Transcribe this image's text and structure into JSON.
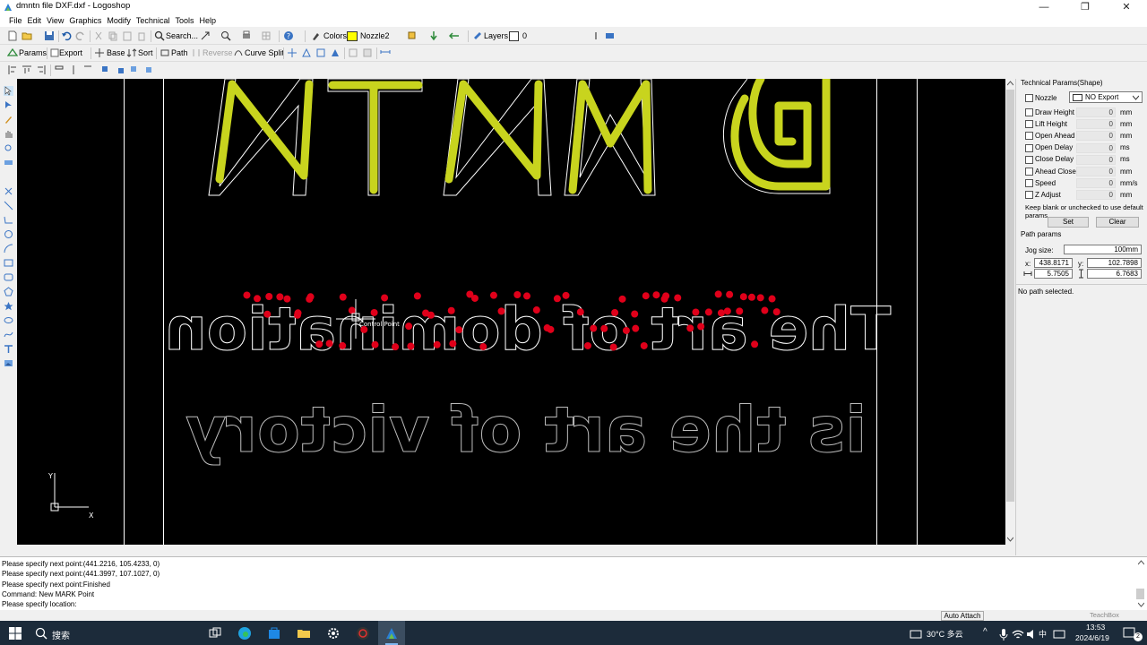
{
  "window": {
    "title": "dmntn file DXF.dxf - Logoshop",
    "minimize_glyph": "—",
    "maximize_glyph": "❐",
    "close_glyph": "✕"
  },
  "menu": [
    "File",
    "Edit",
    "View",
    "Graphics",
    "Modify",
    "Technical",
    "Tools",
    "Help"
  ],
  "toolbar1": {
    "search_label": "Search...",
    "colors_label": "Colors",
    "nozzle_label": "Nozzle2",
    "nozzle_color": "#ffff00",
    "layers_label": "Layers",
    "layer_value": "0"
  },
  "toolbar2": {
    "params_label": "Params",
    "export_label": "Export",
    "base_label": "Base",
    "sort_label": "Sort",
    "path_label": "Path",
    "reverse_label": "Reverse",
    "curve_split_label": "Curve Split"
  },
  "canvas": {
    "background": "#000000",
    "accent_fill": "#c8d41e",
    "control_point_color": "#e0001a",
    "line1": "dmntn@",
    "line2": "The art of domination",
    "line3": "is the art of victory",
    "tooltip": "Control Point",
    "axis_y": "Y",
    "axis_x": "X"
  },
  "technical_params": {
    "title": "Technical Params(Shape)",
    "nozzle_label": "Nozzle",
    "nozzle_select": "NO Export",
    "rows": [
      {
        "label": "Draw Height",
        "value": "0",
        "unit": "mm"
      },
      {
        "label": "Lift Height",
        "value": "0",
        "unit": "mm"
      },
      {
        "label": "Open Ahead",
        "value": "0",
        "unit": "mm"
      },
      {
        "label": "Open Delay",
        "value": "0",
        "unit": "ms"
      },
      {
        "label": "Close Delay",
        "value": "0",
        "unit": "ms"
      },
      {
        "label": "Ahead Close",
        "value": "0",
        "unit": "mm"
      },
      {
        "label": "Speed",
        "value": "0",
        "unit": "mm/s"
      },
      {
        "label": "Z Adjust",
        "value": "0",
        "unit": "mm"
      }
    ],
    "hint": "Keep blank or unchecked to use default params",
    "set_label": "Set",
    "clear_label": "Clear"
  },
  "path_params": {
    "title": "Path params",
    "jog_label": "Jog size:",
    "jog_value": "100mm",
    "x_label": "x:",
    "x_value": "438.8171",
    "y_label": "y:",
    "y_value": "102.7898",
    "w_value": "5.7505",
    "h_value": "6.7683",
    "status": "No path selected."
  },
  "command_log": [
    "Please specify next point:(441.2216, 105.4233, 0)",
    "Please specify next point:(441.3997, 107.1027, 0)",
    "Please specify next point:Finished",
    "Command: New MARK Point",
    "Please specify location:"
  ],
  "status": {
    "auto_attach": "Auto Attach",
    "teachbox": "TeachBox Disconne"
  },
  "taskbar": {
    "search": "搜索",
    "weather": "30°C 多云",
    "ime": "中",
    "time": "13:53",
    "date": "2024/6/19",
    "notif_count": "2"
  }
}
